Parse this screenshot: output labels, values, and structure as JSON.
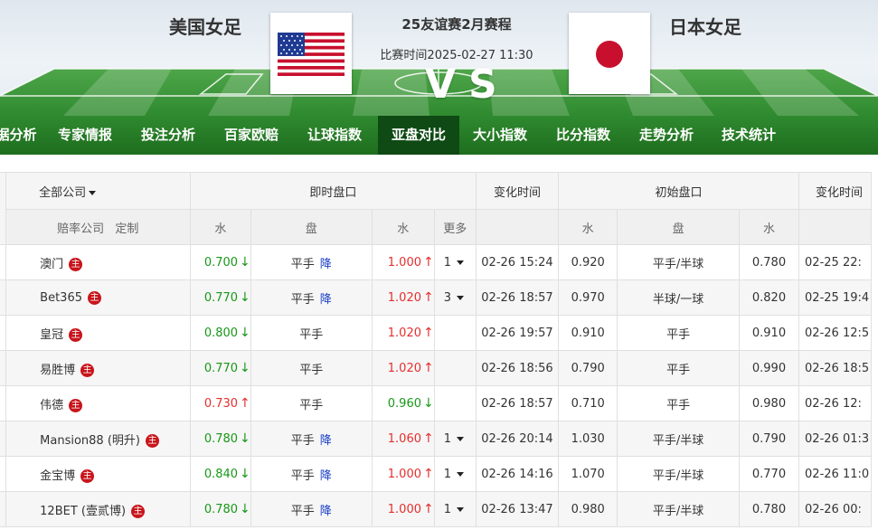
{
  "header": {
    "home_team": "美国女足",
    "away_team": "日本女足",
    "match_title": "25友谊赛2月赛程",
    "match_time": "比赛时间2025-02-27 11:30",
    "vs": "VS"
  },
  "nav": {
    "items": [
      "据分析",
      "专家情报",
      "投注分析",
      "百家欧赔",
      "让球指数",
      "亚盘对比",
      "大小指数",
      "比分指数",
      "走势分析",
      "技术统计"
    ],
    "active": "亚盘对比"
  },
  "table": {
    "group_headers": {
      "company_filter": "全部公司",
      "live": "即时盘口",
      "change_time": "变化时间",
      "initial": "初始盘口",
      "change_time2": "变化时间"
    },
    "sub_headers": {
      "company": "赔率公司",
      "customize": "定制",
      "water1": "水",
      "handicap": "盘",
      "water2": "水",
      "more": "更多",
      "init_water1": "水",
      "init_handicap": "盘",
      "init_water2": "水"
    },
    "badge_label": "主",
    "drop_label": "降",
    "rows": [
      {
        "company": "澳门",
        "w1": "0.700",
        "w1_dir": "down",
        "pan": "平手",
        "drop": true,
        "w2": "1.000",
        "w2_dir": "up",
        "more": "1",
        "time": "02-26 15:24",
        "iw1": "0.920",
        "ipan": "平手/半球",
        "iw2": "0.780",
        "itime": "02-25 22:"
      },
      {
        "company": "Bet365",
        "w1": "0.770",
        "w1_dir": "down",
        "pan": "平手",
        "drop": true,
        "w2": "1.020",
        "w2_dir": "up",
        "more": "3",
        "time": "02-26 18:57",
        "iw1": "0.970",
        "ipan": "半球/一球",
        "iw2": "0.820",
        "itime": "02-25 19:4"
      },
      {
        "company": "皇冠",
        "w1": "0.800",
        "w1_dir": "down",
        "pan": "平手",
        "drop": false,
        "w2": "1.020",
        "w2_dir": "up",
        "more": "",
        "time": "02-26 19:57",
        "iw1": "0.910",
        "ipan": "平手",
        "iw2": "0.910",
        "itime": "02-26 12:5"
      },
      {
        "company": "易胜博",
        "w1": "0.770",
        "w1_dir": "down",
        "pan": "平手",
        "drop": false,
        "w2": "1.020",
        "w2_dir": "up",
        "more": "",
        "time": "02-26 18:56",
        "iw1": "0.790",
        "ipan": "平手",
        "iw2": "0.990",
        "itime": "02-26 18:5"
      },
      {
        "company": "伟德",
        "w1": "0.730",
        "w1_dir": "up",
        "pan": "平手",
        "drop": false,
        "w2": "0.960",
        "w2_dir": "down",
        "more": "",
        "time": "02-26 18:57",
        "iw1": "0.710",
        "ipan": "平手",
        "iw2": "0.980",
        "itime": "02-26 12:"
      },
      {
        "company": "Mansion88 (明升)",
        "w1": "0.780",
        "w1_dir": "down",
        "pan": "平手",
        "drop": true,
        "w2": "1.060",
        "w2_dir": "up",
        "more": "1",
        "time": "02-26 20:14",
        "iw1": "1.030",
        "ipan": "平手/半球",
        "iw2": "0.790",
        "itime": "02-26 01:3"
      },
      {
        "company": "金宝博",
        "w1": "0.840",
        "w1_dir": "down",
        "pan": "平手",
        "drop": true,
        "w2": "1.000",
        "w2_dir": "up",
        "more": "1",
        "time": "02-26 14:16",
        "iw1": "1.070",
        "ipan": "平手/半球",
        "iw2": "0.770",
        "itime": "02-26 11:0"
      },
      {
        "company": "12BET (壹贰博)",
        "w1": "0.780",
        "w1_dir": "down",
        "pan": "平手",
        "drop": true,
        "w2": "1.000",
        "w2_dir": "up",
        "more": "1",
        "time": "02-26 13:47",
        "iw1": "0.980",
        "ipan": "平手/半球",
        "iw2": "0.780",
        "itime": "02-26 00:"
      }
    ]
  },
  "colors": {
    "nav_bg": "#267c26",
    "nav_active": "#0f4a14",
    "down": "#179817",
    "up": "#e62e2e",
    "drop": "#1a3fc8",
    "badge": "#c9141b"
  }
}
